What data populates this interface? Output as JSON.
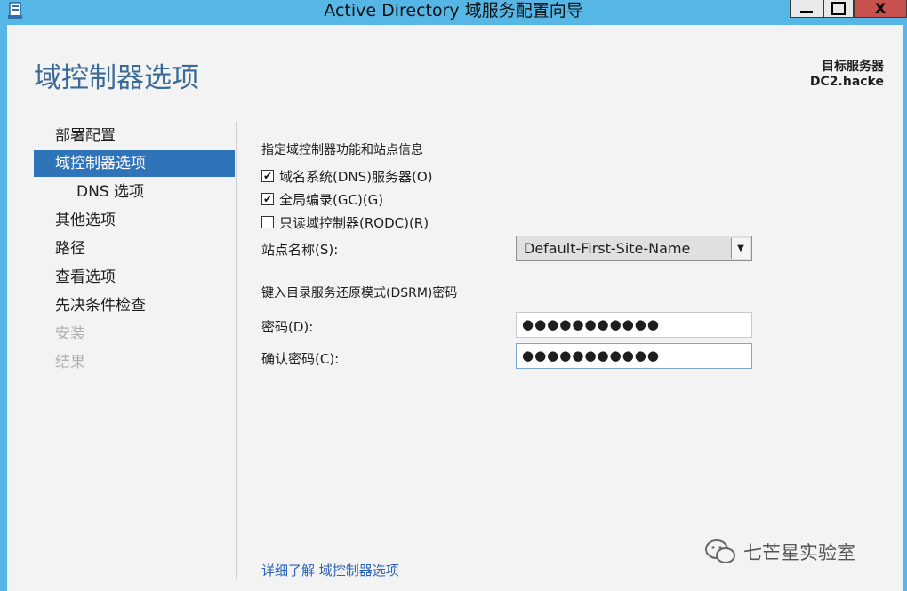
{
  "window": {
    "title": "Active Directory 域服务配置向导",
    "close_glyph": "X"
  },
  "header": {
    "page_title": "域控制器选项",
    "target_label": "目标服务器",
    "target_name": "DC2.hacke"
  },
  "nav": {
    "items": [
      {
        "label": "部署配置"
      },
      {
        "label": "域控制器选项"
      },
      {
        "label": "DNS 选项"
      },
      {
        "label": "其他选项"
      },
      {
        "label": "路径"
      },
      {
        "label": "查看选项"
      },
      {
        "label": "先决条件检查"
      },
      {
        "label": "安装"
      },
      {
        "label": "结果"
      }
    ]
  },
  "main": {
    "section1": "指定域控制器功能和站点信息",
    "options": [
      {
        "label": "域名系统(DNS)服务器(O)",
        "checked": true
      },
      {
        "label": "全局编录(GC)(G)",
        "checked": true
      },
      {
        "label": "只读域控制器(RODC)(R)",
        "checked": false
      }
    ],
    "site_label": "站点名称(S):",
    "site_value": "Default-First-Site-Name",
    "section2": "键入目录服务还原模式(DSRM)密码",
    "password_label": "密码(D):",
    "password_value": "●●●●●●●●●●●",
    "confirm_label": "确认密码(C):",
    "confirm_value": "●●●●●●●●●●●",
    "learn_more": "详细了解 域控制器选项"
  },
  "watermark": {
    "text": "七芒星实验室"
  }
}
